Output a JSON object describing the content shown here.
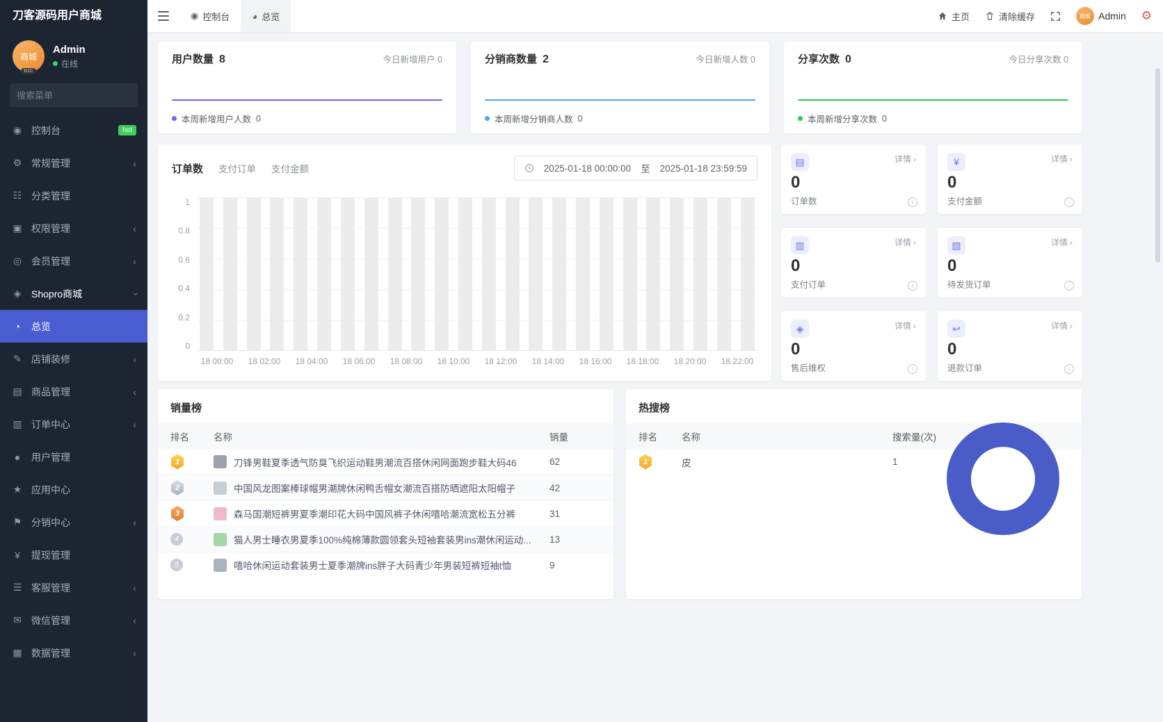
{
  "app": {
    "title": "刀客源码用户商城"
  },
  "colors": {
    "accent": "#4a5dd0",
    "sidebar_bg": "#1d2533",
    "hot_badge": "#3ecf5e",
    "donut": "#4a5cc8"
  },
  "icons": {
    "detail_arrow": "›",
    "chevron": "‹",
    "info": "i",
    "gear": "⚙"
  },
  "topbar": {
    "tab_console": "控制台",
    "tab_overview": "总览",
    "home": "主页",
    "clear_cache": "清除缓存",
    "admin_name": "Admin",
    "avatar_text": "商城"
  },
  "sidebar": {
    "user": {
      "avatar_text": "商城",
      "avatar_badge": "B2C",
      "name": "Admin",
      "status": "在线"
    },
    "search_placeholder": "搜索菜单",
    "items": [
      {
        "label": "控制台",
        "icon": "◉",
        "badge": "hot"
      },
      {
        "label": "常规管理",
        "icon": "⚙"
      },
      {
        "label": "分类管理",
        "icon": "☷"
      },
      {
        "label": "权限管理",
        "icon": "▣"
      },
      {
        "label": "会员管理",
        "icon": "◎"
      },
      {
        "label": "Shopro商城",
        "icon": "◈"
      },
      {
        "label": "总览",
        "icon": "◔"
      },
      {
        "label": "店铺装修",
        "icon": "✎"
      },
      {
        "label": "商品管理",
        "icon": "▤"
      },
      {
        "label": "订单中心",
        "icon": "▥"
      },
      {
        "label": "用户管理",
        "icon": "●"
      },
      {
        "label": "应用中心",
        "icon": "★"
      },
      {
        "label": "分销中心",
        "icon": "⚑"
      },
      {
        "label": "提现管理",
        "icon": "¥"
      },
      {
        "label": "客服管理",
        "icon": "☰"
      },
      {
        "label": "微信管理",
        "icon": "✉"
      },
      {
        "label": "数据管理",
        "icon": "▦"
      }
    ]
  },
  "stat_cards": [
    {
      "title": "用户数量",
      "value": "8",
      "today_label": "今日新增用户",
      "today_value": "0",
      "week_label": "本周新增用户人数",
      "week_value": "0",
      "color": "#7d5cf5"
    },
    {
      "title": "分销商数量",
      "value": "2",
      "today_label": "今日新增人数",
      "today_value": "0",
      "week_label": "本周新增分销商人数",
      "week_value": "0",
      "color": "#4da3f7"
    },
    {
      "title": "分享次数",
      "value": "0",
      "today_label": "今日分享次数",
      "today_value": "0",
      "week_label": "本周新增分享次数",
      "week_value": "0",
      "color": "#2fcb53"
    }
  ],
  "order_chart": {
    "tabs": [
      "订单数",
      "支付订单",
      "支付金额"
    ],
    "active_tab": "订单数",
    "date_start": "2025-01-18 00:00:00",
    "date_separator": "至",
    "date_end": "2025-01-18 23:59:59",
    "y_ticks": [
      "1",
      "0.8",
      "0.6",
      "0.4",
      "0.2",
      "0"
    ],
    "x_labels": [
      "18 00:00",
      "18 02:00",
      "18 04:00",
      "18 06:00",
      "18 08:00",
      "18 10:00",
      "18 12:00",
      "18 14:00",
      "18 16:00",
      "18 18:00",
      "18 20:00",
      "18 22:00"
    ],
    "values": [
      0,
      0,
      0,
      0,
      0,
      0,
      0,
      0,
      0,
      0,
      0,
      0,
      0,
      0,
      0,
      0,
      0,
      0,
      0,
      0,
      0,
      0,
      0,
      0
    ],
    "background_bars": [
      1,
      1,
      1,
      1,
      1,
      1,
      1,
      1,
      1,
      1,
      1,
      1,
      1,
      1,
      1,
      1,
      1,
      1,
      1,
      1,
      1,
      1,
      1,
      1
    ],
    "ylim": [
      0,
      1
    ]
  },
  "mini_cards": [
    {
      "label": "订单数",
      "value": "0",
      "detail": "详情",
      "icon": "▤"
    },
    {
      "label": "支付金额",
      "value": "0",
      "detail": "详情",
      "icon": "¥"
    },
    {
      "label": "支付订单",
      "value": "0",
      "detail": "详情",
      "icon": "▥"
    },
    {
      "label": "待发货订单",
      "value": "0",
      "detail": "详情",
      "icon": "▧"
    },
    {
      "label": "售后维权",
      "value": "0",
      "detail": "详情",
      "icon": "◈"
    },
    {
      "label": "退款订单",
      "value": "0",
      "detail": "详情",
      "icon": "↩"
    }
  ],
  "sales_rank": {
    "title": "销量榜",
    "headers": [
      "排名",
      "名称",
      "销量"
    ],
    "rows": [
      {
        "rank": "1",
        "name": "刀锋男鞋夏季透气防臭飞织运动鞋男潮流百搭休闲网面跑步鞋大码46",
        "value": "62",
        "thumb_color": "#9aa3ad"
      },
      {
        "rank": "2",
        "name": "中国风龙图案棒球帽男潮牌休闲鸭舌帽女潮流百搭防晒遮阳太阳帽子",
        "value": "42",
        "thumb_color": "#c6ced4"
      },
      {
        "rank": "3",
        "name": "森马国潮短裤男夏季潮印花大码中国风裤子休闲嘻哈潮流宽松五分裤",
        "value": "31",
        "thumb_color": "#f0b9c8"
      },
      {
        "rank": "4",
        "name": "猫人男士睡衣男夏季100%纯棉薄款圆领套头短袖套装男ins潮休闲运动...",
        "value": "13",
        "thumb_color": "#a5d6a7"
      },
      {
        "rank": "5",
        "name": "嘻哈休闲运动套装男士夏季潮牌ins胖子大码青少年男装短裤短袖t恤",
        "value": "9",
        "thumb_color": "#aab2bb"
      }
    ]
  },
  "hot_search": {
    "title": "热搜榜",
    "headers": [
      "排名",
      "名称",
      "搜索量(次)"
    ],
    "rows": [
      {
        "rank": "1",
        "name": "皮",
        "value": "1"
      }
    ]
  }
}
